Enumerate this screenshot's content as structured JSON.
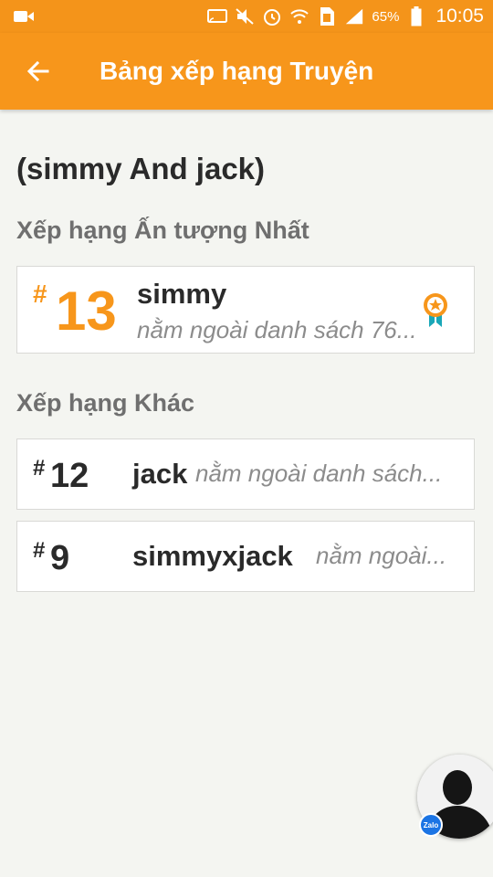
{
  "status_bar": {
    "battery_percent": "65%",
    "time": "10:05",
    "icons": [
      "video-camera-icon",
      "screen-cast-icon",
      "mute-icon",
      "alarm-icon",
      "wifi-icon",
      "sim-icon",
      "signal-icon",
      "battery-icon"
    ]
  },
  "app_bar": {
    "title": "Bảng xếp hạng Truyện",
    "back_icon": "arrow-left-icon"
  },
  "story": {
    "title": "(simmy And jack)"
  },
  "sections": {
    "impressive_label": "Xếp hạng Ấn tượng Nhất",
    "other_label": "Xếp hạng Khác"
  },
  "top_rank": {
    "hash": "#",
    "rank": "13",
    "name": "simmy",
    "description": "nằm ngoài danh sách 76...",
    "badge_icon": "medal-icon"
  },
  "other_ranks": [
    {
      "hash": "#",
      "rank": "12",
      "name": "jack",
      "description": "nằm ngoài danh sách..."
    },
    {
      "hash": "#",
      "rank": "9",
      "name": "simmyxjack",
      "description": "nằm ngoài..."
    }
  ],
  "floating": {
    "badge_text": "Zalo",
    "colors": {
      "badge": "#1b74e4"
    }
  },
  "colors": {
    "accent": "#f7961b",
    "background": "#f4f5f1",
    "text_dark": "#2a2a2a",
    "text_muted": "#8c8c8c"
  }
}
